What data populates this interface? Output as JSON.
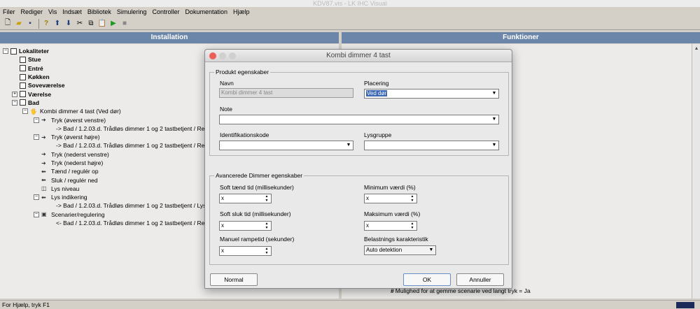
{
  "window": {
    "title": "KDV87.vis - LK IHC Visual"
  },
  "menu": [
    "Filer",
    "Rediger",
    "Vis",
    "Indsæt",
    "Bibliotek",
    "Simulering",
    "Controller",
    "Dokumentation",
    "Hjælp"
  ],
  "toolbar": {
    "icons": [
      "new-icon",
      "open-icon",
      "save-icon",
      "help-icon",
      "upload-icon",
      "download-icon",
      "cut-icon",
      "copy-icon",
      "paste-icon",
      "run-icon",
      "stop-icon"
    ]
  },
  "panes": {
    "left_title": "Installation",
    "right_title": "Funktioner"
  },
  "tree": {
    "root": "Lokaliteter",
    "rooms": [
      "Stue",
      "Entré",
      "Køkken",
      "Soveværelse",
      "Værelse",
      "Bad"
    ],
    "product": "Kombi dimmer 4 tast (Ved dør)",
    "items": [
      {
        "label": "Tryk (øverst venstre)"
      },
      {
        "label": "-> Bad / 1.2.03.d. Trådløs dimmer 1 og 2 tastbetjent / Reg"
      },
      {
        "label": "Tryk (øverst højre)"
      },
      {
        "label": "-> Bad / 1.2.03.d. Trådløs dimmer 1 og 2 tastbetjent / Reg"
      },
      {
        "label": "Tryk (nederst venstre)"
      },
      {
        "label": "Tryk (nederst højre)"
      },
      {
        "label": "Tænd / regulér op"
      },
      {
        "label": "Sluk / regulér ned"
      },
      {
        "label": "Lys niveau"
      },
      {
        "label": "Lys indikering"
      },
      {
        "label": "-> Bad / 1.2.03.d. Trådløs dimmer 1 og 2 tastbetjent / Lysi"
      },
      {
        "label": "Scenarier/regulering"
      },
      {
        "label": "<- Bad / 1.2.03.d. Trådløs dimmer 1 og 2 tastbetjent / Reg"
      }
    ]
  },
  "right_note": "Mulighed for at gemme scenarie ved langt tryk = Ja",
  "status": {
    "text": "For Hjælp, tryk F1"
  },
  "dialog": {
    "title": "Kombi dimmer 4 tast",
    "group1": "Produkt egenskaber",
    "navn_label": "Navn",
    "navn_value": "Kombi dimmer 4 tast",
    "placering_label": "Placering",
    "placering_value": "Ved dør",
    "note_label": "Note",
    "note_value": "",
    "ident_label": "Identifikationskode",
    "ident_value": "",
    "lysgruppe_label": "Lysgruppe",
    "lysgruppe_value": "",
    "group2": "Avancerede Dimmer egenskaber",
    "soft_taend_label": "Soft tænd tid (millisekunder)",
    "soft_taend_value": "x",
    "min_label": "Minimum værdi (%)",
    "min_value": "x",
    "soft_sluk_label": "Soft sluk tid (millisekunder)",
    "soft_sluk_value": "x",
    "max_label": "Maksimum værdi (%)",
    "max_value": "x",
    "rampe_label": "Manuel rampetid (sekunder)",
    "rampe_value": "x",
    "belast_label": "Belastnings karakteristik",
    "belast_value": "Auto detektion",
    "normal_button": "Normal",
    "ok_button": "OK",
    "cancel_button": "Annuller"
  }
}
